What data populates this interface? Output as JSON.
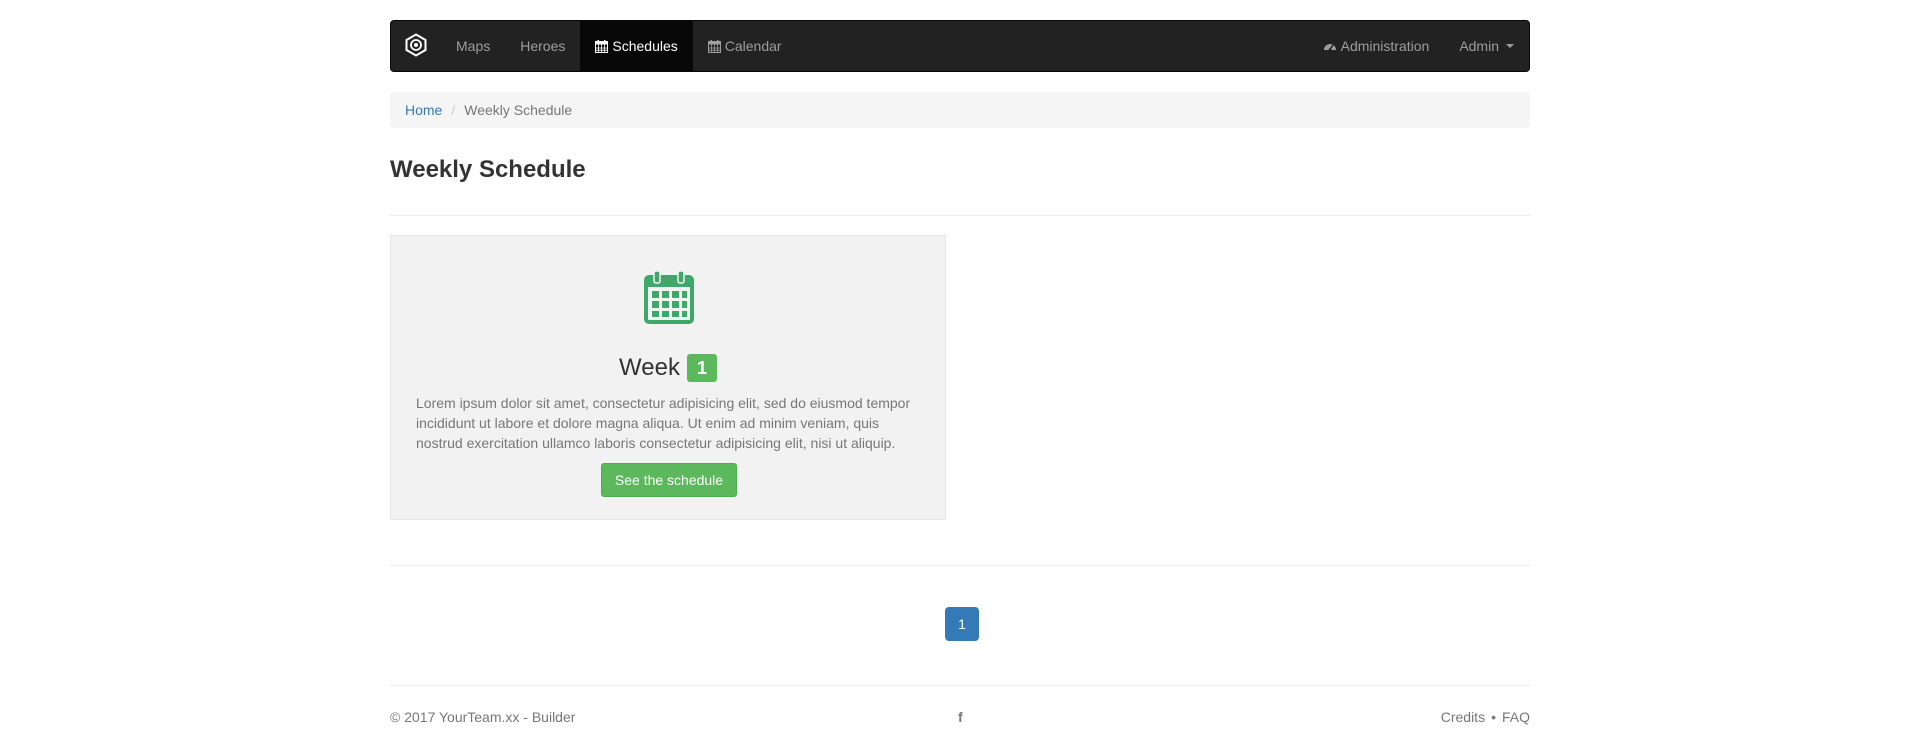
{
  "navbar": {
    "brand_icon": "hexagon-logo-icon",
    "left_items": [
      {
        "label": "Maps",
        "icon": null,
        "active": false
      },
      {
        "label": "Heroes",
        "icon": null,
        "active": false
      },
      {
        "label": "Schedules",
        "icon": "calendar-icon",
        "active": true
      },
      {
        "label": "Calendar",
        "icon": "calendar-icon",
        "active": false
      }
    ],
    "administration_label": "Administration",
    "administration_icon": "dashboard-icon",
    "admin_label": "Admin"
  },
  "breadcrumb": {
    "home": "Home",
    "separator": "/",
    "current": "Weekly Schedule"
  },
  "page": {
    "title": "Weekly Schedule"
  },
  "card": {
    "icon": "calendar-icon",
    "icon_color": "#3ea86b",
    "title": "Week",
    "badge": "1",
    "text": "Lorem ipsum dolor sit amet, consectetur adipisicing elit, sed do eiusmod tempor incididunt ut labore et dolore magna aliqua. Ut enim ad minim veniam, quis nostrud exercitation ullamco laboris consectetur adipisicing elit, nisi ut aliquip.",
    "button_label": "See the schedule"
  },
  "pagination": {
    "current_page": "1"
  },
  "footer": {
    "copyright": "© 2017 YourTeam.xx - Builder",
    "facebook_icon": "facebook-icon",
    "facebook_glyph": "f",
    "links": [
      "Credits",
      "FAQ"
    ],
    "links_separator": "•"
  },
  "colors": {
    "navbar_bg": "#222222",
    "link_blue": "#337ab7",
    "success_green": "#5cb85c"
  }
}
